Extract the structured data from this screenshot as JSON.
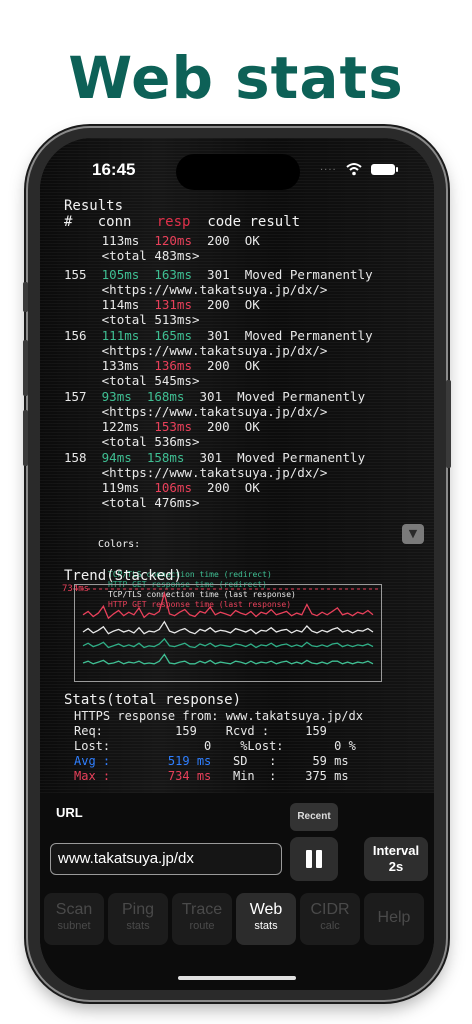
{
  "headline": "Web stats",
  "status": {
    "time": "16:45",
    "signal": "....",
    "wifi_icon": "wifi-icon",
    "battery_icon": "battery-icon"
  },
  "results": {
    "title": "Results",
    "header": {
      "num": "#",
      "conn": "conn",
      "resp": "resp",
      "code": "code",
      "result": "result"
    },
    "first_partial": {
      "conn": "113ms",
      "resp": "120ms",
      "code": "200",
      "result": "OK",
      "total": "<total 483ms>"
    },
    "entries": [
      {
        "num": "155",
        "conn": "105ms",
        "resp": "163ms",
        "code": "301",
        "result": "Moved Permanently",
        "location": "<https://www.takatsuya.jp/dx/>",
        "conn2": "114ms",
        "resp2": "131ms",
        "code2": "200",
        "result2": "OK",
        "total": "<total 513ms>"
      },
      {
        "num": "156",
        "conn": "111ms",
        "resp": "165ms",
        "code": "301",
        "result": "Moved Permanently",
        "location": "<https://www.takatsuya.jp/dx/>",
        "conn2": "133ms",
        "resp2": "136ms",
        "code2": "200",
        "result2": "OK",
        "total": "<total 545ms>"
      },
      {
        "num": "157",
        "conn": "93ms",
        "resp": "168ms",
        "code": "301",
        "result": "Moved Permanently",
        "location": "<https://www.takatsuya.jp/dx/>",
        "conn2": "122ms",
        "resp2": "153ms",
        "code2": "200",
        "result2": "OK",
        "total": "<total 536ms>"
      },
      {
        "num": "158",
        "conn": "94ms",
        "resp": "158ms",
        "code": "301",
        "result": "Moved Permanently",
        "location": "<https://www.takatsuya.jp/dx/>",
        "conn2": "119ms",
        "resp2": "106ms",
        "code2": "200",
        "result2": "OK",
        "total": "<total 476ms>"
      }
    ]
  },
  "legend": {
    "title": "Colors:",
    "items": [
      "TCP/TLS connection time (redirect)",
      "HTTP GET response time (redirect)",
      "TCP/TLS connection time (last response)",
      "HTTP GET response time (last response)"
    ],
    "colors": [
      "#3fbf93",
      "#2fae86",
      "#e8e8e8",
      "#e8405a"
    ]
  },
  "scroll_down_icon": "triangle-down-icon",
  "scroll_down_glyph": "▼",
  "trend": {
    "title": "Trend(Stacked)",
    "max_label": "734ms",
    "series": [
      {
        "color": "#e8405a",
        "values": [
          0.7,
          0.74,
          0.68,
          0.72,
          0.8,
          0.66,
          0.71,
          0.75,
          0.69,
          0.73,
          0.7,
          0.78,
          0.67,
          0.72,
          0.7,
          0.74,
          0.95,
          0.71,
          0.69,
          0.73,
          0.76,
          0.7,
          0.68,
          0.74,
          0.72,
          0.79,
          0.7,
          0.73,
          0.71,
          0.69,
          0.75,
          0.72,
          0.7,
          0.74,
          0.68,
          0.73,
          0.71,
          0.76,
          0.7,
          0.72,
          0.74,
          0.69,
          0.72,
          0.7,
          0.82,
          0.71,
          0.69,
          0.73,
          0.7,
          0.74,
          0.78,
          0.7,
          0.72,
          0.69,
          0.73,
          0.71,
          0.75,
          0.7
        ]
      },
      {
        "color": "#e8e8e8",
        "values": [
          0.5,
          0.54,
          0.49,
          0.52,
          0.56,
          0.48,
          0.51,
          0.53,
          0.5,
          0.52,
          0.49,
          0.55,
          0.48,
          0.51,
          0.5,
          0.53,
          0.62,
          0.51,
          0.49,
          0.52,
          0.54,
          0.5,
          0.48,
          0.53,
          0.51,
          0.55,
          0.5,
          0.52,
          0.51,
          0.49,
          0.54,
          0.52,
          0.5,
          0.53,
          0.48,
          0.52,
          0.51,
          0.55,
          0.5,
          0.52,
          0.53,
          0.49,
          0.52,
          0.5,
          0.57,
          0.51,
          0.49,
          0.52,
          0.5,
          0.53,
          0.55,
          0.5,
          0.52,
          0.49,
          0.52,
          0.51,
          0.54,
          0.5
        ]
      },
      {
        "color": "#2fae86",
        "values": [
          0.34,
          0.37,
          0.33,
          0.35,
          0.38,
          0.32,
          0.34,
          0.36,
          0.33,
          0.35,
          0.33,
          0.37,
          0.32,
          0.34,
          0.33,
          0.36,
          0.42,
          0.34,
          0.33,
          0.35,
          0.37,
          0.33,
          0.32,
          0.36,
          0.34,
          0.37,
          0.33,
          0.35,
          0.34,
          0.33,
          0.36,
          0.35,
          0.33,
          0.36,
          0.32,
          0.35,
          0.34,
          0.37,
          0.33,
          0.35,
          0.36,
          0.33,
          0.35,
          0.33,
          0.38,
          0.34,
          0.33,
          0.35,
          0.33,
          0.36,
          0.37,
          0.33,
          0.35,
          0.33,
          0.35,
          0.34,
          0.36,
          0.33
        ]
      },
      {
        "color": "#3fbf93",
        "values": [
          0.14,
          0.16,
          0.13,
          0.15,
          0.17,
          0.13,
          0.14,
          0.16,
          0.13,
          0.15,
          0.14,
          0.16,
          0.13,
          0.14,
          0.13,
          0.16,
          0.24,
          0.14,
          0.13,
          0.15,
          0.16,
          0.13,
          0.13,
          0.16,
          0.14,
          0.17,
          0.13,
          0.15,
          0.14,
          0.13,
          0.16,
          0.15,
          0.13,
          0.16,
          0.13,
          0.15,
          0.14,
          0.16,
          0.13,
          0.15,
          0.16,
          0.13,
          0.15,
          0.13,
          0.17,
          0.14,
          0.13,
          0.15,
          0.13,
          0.16,
          0.16,
          0.13,
          0.15,
          0.13,
          0.15,
          0.14,
          0.16,
          0.13
        ]
      }
    ]
  },
  "stats": {
    "title": "Stats(total response)",
    "from_line": "HTTPS response from: www.takatsuya.jp/dx",
    "req_label": "Req:",
    "req_value": "159",
    "rcvd_label": "Rcvd :",
    "rcvd_value": "159",
    "lost_label": "Lost:",
    "lost_value": "0",
    "plost_label": "%Lost:",
    "plost_value": "0 %",
    "avg_label": "Avg :",
    "avg_value": "519 ms",
    "sd_label": "SD   :",
    "sd_value": "59 ms",
    "max_label": "Max :",
    "max_value": "734 ms",
    "min_label": "Min  :",
    "min_value": "375 ms"
  },
  "controls": {
    "url_label": "URL",
    "recent_label": "Recent",
    "url_value": "www.takatsuya.jp/dx",
    "pause_icon": "pause-icon",
    "interval_line1": "Interval",
    "interval_line2": "2s"
  },
  "tabs": [
    {
      "line1": "Scan",
      "line2": "subnet"
    },
    {
      "line1": "Ping",
      "line2": "stats"
    },
    {
      "line1": "Trace",
      "line2": "route"
    },
    {
      "line1": "Web",
      "line2": "stats",
      "active": true
    },
    {
      "line1": "CIDR",
      "line2": "calc"
    },
    {
      "line1": "Help",
      "line2": ""
    }
  ]
}
